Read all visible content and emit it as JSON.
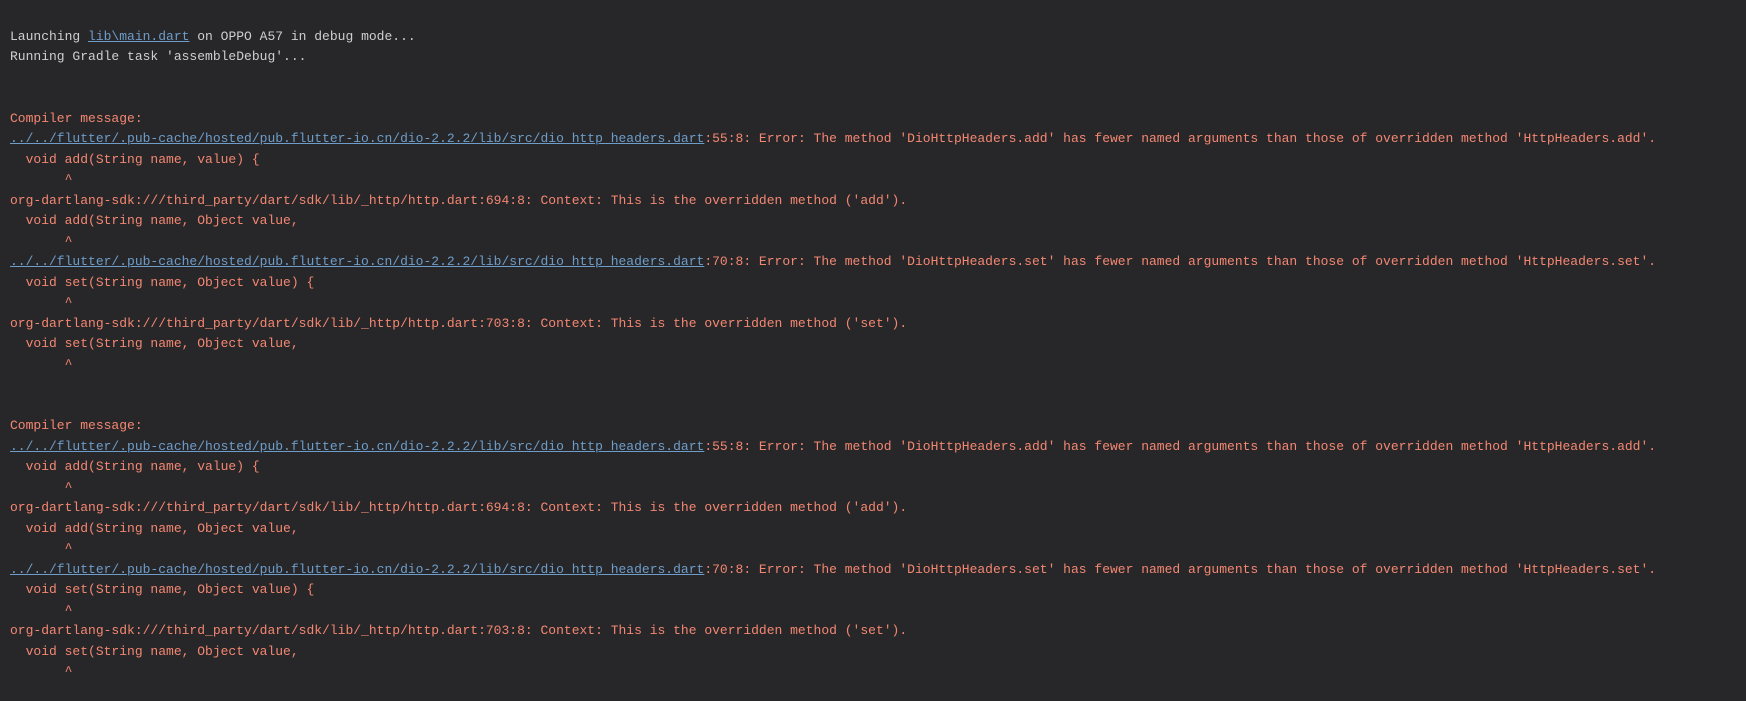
{
  "header": {
    "launch_prefix": "Launching ",
    "launch_link": "lib\\main.dart",
    "launch_suffix": " on OPPO A57 in debug mode...",
    "gradle": "Running Gradle task 'assembleDebug'..."
  },
  "paths": {
    "dio_headers": "../../flutter/.pub-cache/hosted/pub.flutter-io.cn/dio-2.2.2/lib/src/dio_http_headers.dart"
  },
  "err": {
    "compiler_msg": "Compiler message:",
    "add_err_tail": ":55:8: Error: The method 'DioHttpHeaders.add' has fewer named arguments than those of overridden method 'HttpHeaders.add'.",
    "add_sig": "  void add(String name, value) {",
    "caret8": "       ^",
    "add_ctx": "org-dartlang-sdk:///third_party/dart/sdk/lib/_http/http.dart:694:8: Context: This is the overridden method ('add').",
    "add_over_sig": "  void add(String name, Object value,",
    "set_err_tail": ":70:8: Error: The method 'DioHttpHeaders.set' has fewer named arguments than those of overridden method 'HttpHeaders.set'.",
    "set_sig": "  void set(String name, Object value) {",
    "set_ctx": "org-dartlang-sdk:///third_party/dart/sdk/lib/_http/http.dart:703:8: Context: This is the overridden method ('set').",
    "set_over_sig": "  void set(String name, Object value,"
  }
}
